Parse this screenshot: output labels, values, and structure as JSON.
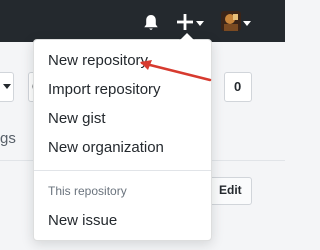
{
  "header": {
    "bell_icon": "bell-icon",
    "plus_icon": "plus-icon",
    "avatar_icon": "avatar-icon"
  },
  "background": {
    "c_label": "C",
    "zero_label": "0",
    "gs_label": "gs",
    "edit_label": "Edit"
  },
  "menu": {
    "items": [
      {
        "label": "New repository"
      },
      {
        "label": "Import repository"
      },
      {
        "label": "New gist"
      },
      {
        "label": "New organization"
      }
    ],
    "section_header": "This repository",
    "section_items": [
      {
        "label": "New issue"
      }
    ]
  },
  "colors": {
    "header_bg": "#24292e",
    "annotation": "#d73a2f"
  }
}
